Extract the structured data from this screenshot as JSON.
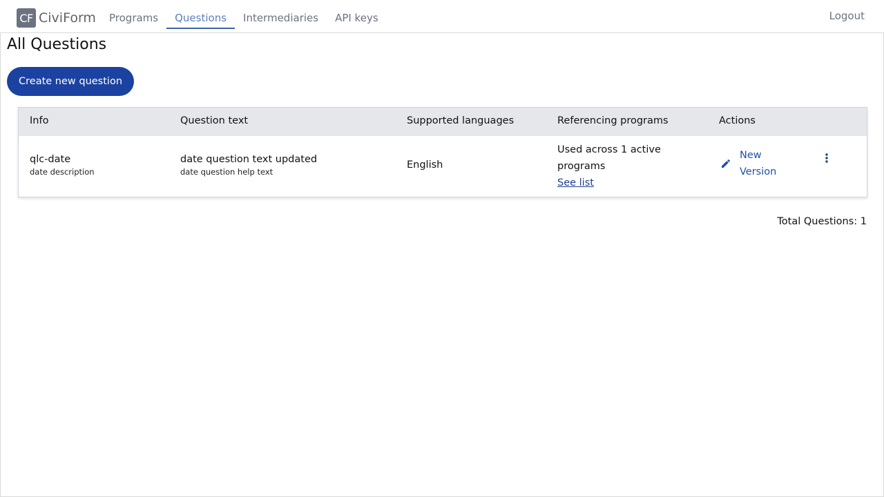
{
  "brand": {
    "badge": "CF",
    "name": "CiviForm"
  },
  "nav": {
    "items": [
      {
        "label": "Programs"
      },
      {
        "label": "Questions"
      },
      {
        "label": "Intermediaries"
      },
      {
        "label": "API keys"
      }
    ],
    "active": "Questions",
    "logout": "Logout"
  },
  "page": {
    "title": "All Questions",
    "create_button": "Create new question"
  },
  "table": {
    "headers": [
      "Info",
      "Question text",
      "Supported languages",
      "Referencing programs",
      "Actions"
    ],
    "rows": [
      {
        "name": "qlc-date",
        "description": "date description",
        "question_text": "date question text updated",
        "help_text": "date question help text",
        "languages": "English",
        "referencing_line1": "Used across 1 active",
        "referencing_line2": "programs",
        "see_list": "See list",
        "action_line1": "New",
        "action_line2": "Version"
      }
    ]
  },
  "total": "Total Questions: 1",
  "colors": {
    "primary": "#1b42a0",
    "link": "#1f4fa8",
    "header_bg": "#e5e7eb",
    "nav_active": "#3b63a8"
  },
  "icons": {
    "edit": "pencil-icon",
    "more": "more-vertical-icon"
  }
}
